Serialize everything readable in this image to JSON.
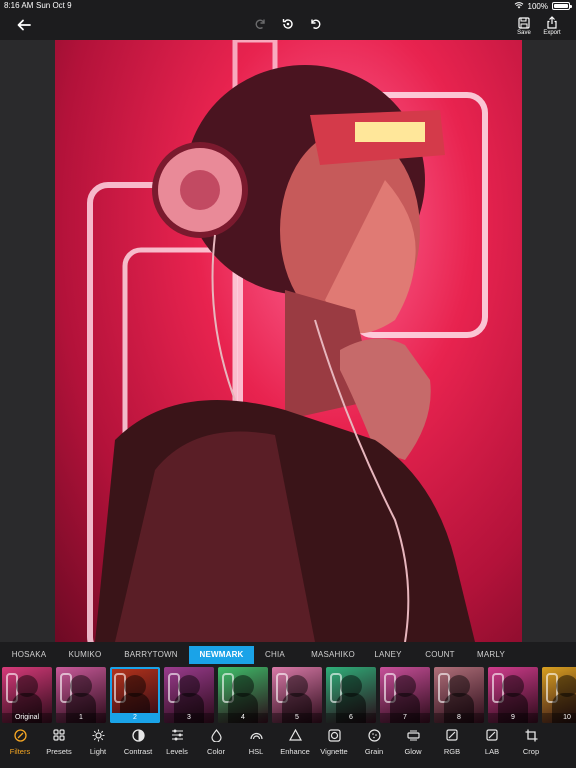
{
  "status_bar": {
    "time": "8:16 AM",
    "date": "Sun Oct 9",
    "battery": "100%"
  },
  "toolbar": {
    "save_label": "Save",
    "export_label": "Export"
  },
  "filters": {
    "names": [
      "HOSAKA",
      "KUMIKO",
      "BARRYTOWN",
      "NEWMARK",
      "CHIA",
      "MASAHIKO",
      "LANEY",
      "COUNT",
      "MARLY"
    ],
    "active": "NEWMARK",
    "thumbnails": [
      {
        "label": "Original",
        "color": "#d63b7a"
      },
      {
        "label": "1",
        "color": "#c85a9a"
      },
      {
        "label": "2",
        "color": "#b8341a"
      },
      {
        "label": "3",
        "color": "#9a3c8e"
      },
      {
        "label": "4",
        "color": "#3fbf6a"
      },
      {
        "label": "5",
        "color": "#d97aa8"
      },
      {
        "label": "6",
        "color": "#2fb07a"
      },
      {
        "label": "7",
        "color": "#c8509a"
      },
      {
        "label": "8",
        "color": "#b0707a"
      },
      {
        "label": "9",
        "color": "#cf3c8c"
      },
      {
        "label": "10",
        "color": "#d9a020"
      }
    ],
    "active_thumbnail": "2"
  },
  "tools": [
    {
      "label": "Filters",
      "icon": "filters-icon"
    },
    {
      "label": "Presets",
      "icon": "presets-icon"
    },
    {
      "label": "Light",
      "icon": "light-icon"
    },
    {
      "label": "Contrast",
      "icon": "contrast-icon"
    },
    {
      "label": "Levels",
      "icon": "levels-icon"
    },
    {
      "label": "Color",
      "icon": "color-drop-icon"
    },
    {
      "label": "HSL",
      "icon": "hsl-icon"
    },
    {
      "label": "Enhance",
      "icon": "enhance-icon"
    },
    {
      "label": "Vignette",
      "icon": "vignette-icon"
    },
    {
      "label": "Grain",
      "icon": "grain-icon"
    },
    {
      "label": "Glow",
      "icon": "glow-icon"
    },
    {
      "label": "RGB",
      "icon": "rgb-icon"
    },
    {
      "label": "LAB",
      "icon": "lab-icon"
    },
    {
      "label": "Crop",
      "icon": "crop-icon"
    }
  ],
  "active_tool": "Filters",
  "colors": {
    "accent": "#1aa3e8",
    "active_tool": "#f5a623",
    "background": "#1c1c1e"
  }
}
